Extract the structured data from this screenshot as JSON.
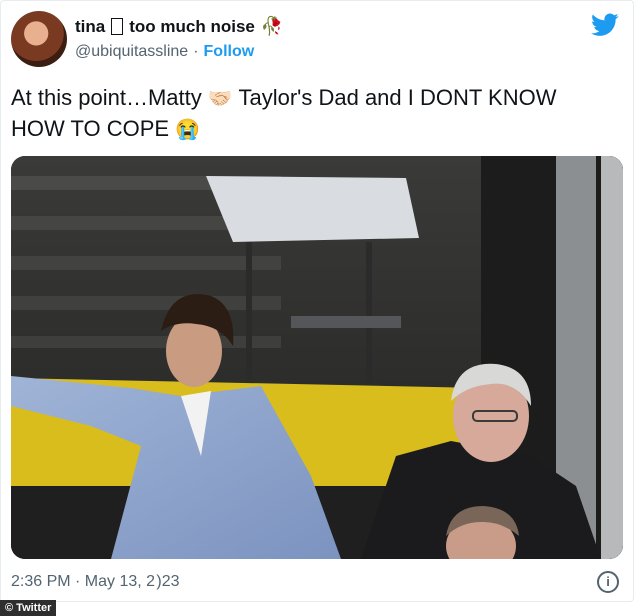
{
  "tweet": {
    "display_name": "tina",
    "display_name_tail": "too much noise",
    "rose_emoji": "🥀",
    "handle": "@ubiquitassline",
    "separator": "·",
    "follow_label": "Follow",
    "text_part1": "At this point…Matty ",
    "handshake_emoji": "🤝🏻",
    "text_part2": " Taylor's Dad and I DONT KNOW HOW TO COPE ",
    "crying_emoji": "😭",
    "timestamp": "2:36 PM · May 13, 2 )23",
    "info_glyph": "i"
  },
  "credit": {
    "label": "© Twitter"
  },
  "colors": {
    "brand": "#1d9bf0",
    "muted": "#536471",
    "text": "#0f1419"
  },
  "icons": {
    "logo": "twitter-bird-icon",
    "info": "info-icon"
  }
}
